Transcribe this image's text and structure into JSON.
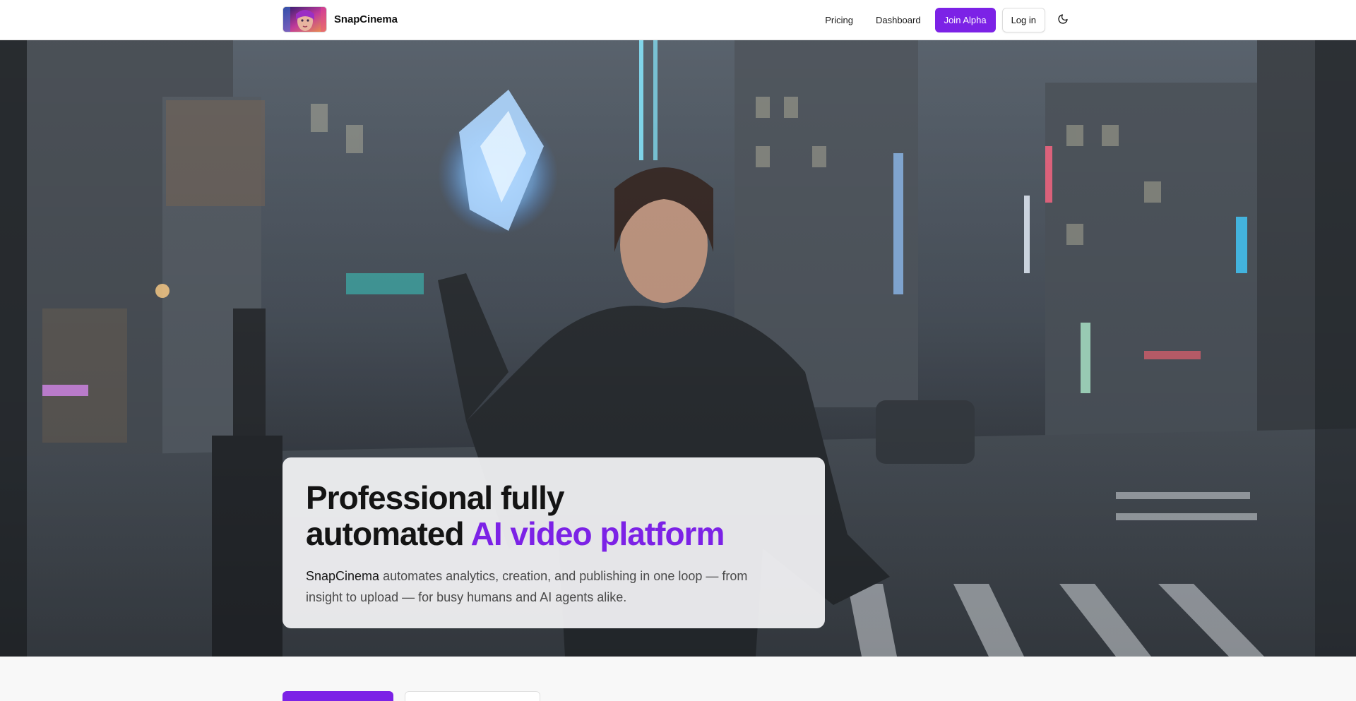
{
  "header": {
    "brand": "SnapCinema",
    "nav": {
      "pricing": "Pricing",
      "dashboard": "Dashboard",
      "join": "Join Alpha",
      "login": "Log in"
    },
    "icons": {
      "logo": "brand-thumbnail",
      "theme": "moon-icon"
    }
  },
  "hero": {
    "headline_line1": "Professional fully",
    "headline_line2_prefix": "automated ",
    "headline_accent": "AI video platform",
    "sub_brand": "SnapCinema",
    "sub_text": " automates analytics, creation, and publishing in one loop — from insight to upload — for busy humans and AI agents alike."
  },
  "colors": {
    "accent": "#7c22e6",
    "header_bg": "#ffffff",
    "card_bg": "#f4f4f6"
  }
}
